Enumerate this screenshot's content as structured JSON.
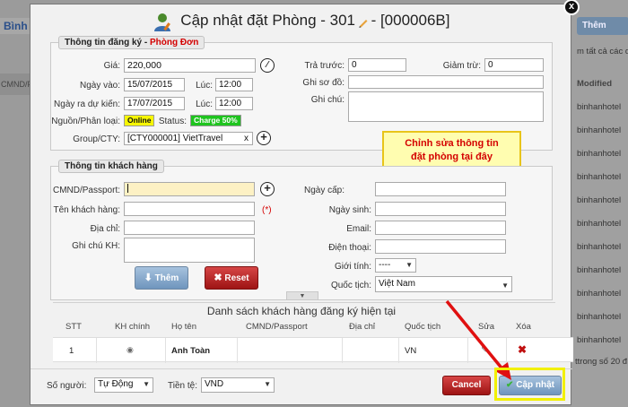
{
  "background": {
    "left_title": "Bình",
    "left_column": "CMND/P",
    "add_button": "Thêm",
    "note": "m tất cả các d",
    "modified_header": "Modified",
    "cells": [
      "binhanhotel",
      "binhanhotel",
      "binhanhotel",
      "binhanhotel",
      "binhanhotel",
      "binhanhotel",
      "binhanhotel",
      "binhanhotel",
      "binhanhotel",
      "binhanhotel",
      "binhanhotel"
    ],
    "footer": "ttrong số 20 đ"
  },
  "dialog": {
    "title": "Cập nhật đặt Phòng - 301",
    "title_suffix": "- [000006B]",
    "close": "x"
  },
  "registration": {
    "legend": "Thông tin đăng ký",
    "legend_sep": " - ",
    "legend_type": "Phòng Đơn",
    "price_label": "Giá:",
    "price_value": "220,000",
    "checkin_label": "Ngày vào:",
    "checkin_date": "15/07/2015",
    "checkin_time_label": "Lúc:",
    "checkin_time": "12:00",
    "checkout_label": "Ngày ra dự kiến:",
    "checkout_date": "17/07/2015",
    "checkout_time_label": "Lúc:",
    "checkout_time": "12:00",
    "source_label": "Nguồn/Phân loại:",
    "source_value": "Online",
    "status_label": "Status:",
    "status_value": "Charge 50%",
    "group_label": "Group/CTY:",
    "group_value": "[CTY000001] VietTravel",
    "group_clear": "x",
    "prepaid_label": "Trả trước:",
    "prepaid_value": "0",
    "discount_label": "Giảm trừ:",
    "discount_value": "0",
    "ledger_label": "Ghi sơ đồ:",
    "note_label": "Ghi chú:"
  },
  "callout": {
    "line1": "Chỉnh sửa thông tin",
    "line2": "đặt phòng tại đây"
  },
  "customer": {
    "legend": "Thông tin khách hàng",
    "id_label": "CMND/Passport:",
    "name_label": "Tên khách hàng:",
    "required_mark": "(*)",
    "address_label": "Địa chỉ:",
    "note_label": "Ghi chú KH:",
    "issue_date_label": "Ngày cấp:",
    "birth_label": "Ngày sinh:",
    "email_label": "Email:",
    "phone_label": "Điện thoại:",
    "gender_label": "Giới tính:",
    "gender_value": "----",
    "nationality_label": "Quốc tịch:",
    "nationality_value": "Việt Nam",
    "add_button": "Thêm",
    "reset_button": "Reset"
  },
  "guest_list": {
    "title": "Danh sách khách hàng đăng ký hiện tại",
    "headers": [
      "STT",
      "KH chính",
      "Họ tên",
      "CMND/Passport",
      "Địa chỉ",
      "Quốc tịch",
      "Sửa",
      "Xóa"
    ],
    "rows": [
      {
        "stt": "1",
        "name": "Anh Toàn",
        "passport": "",
        "address": "",
        "nationality": "VN"
      }
    ]
  },
  "footer": {
    "people_label": "Số người:",
    "people_value": "Tự Động",
    "currency_label": "Tiền tệ:",
    "currency_value": "VND",
    "cancel_button": "Cancel",
    "update_button": "Cập nhật"
  },
  "colors": {
    "accent_red": "#d40000",
    "online_badge": "#f6f600",
    "status_badge": "#1ec41e",
    "highlight": "#f2f000"
  }
}
